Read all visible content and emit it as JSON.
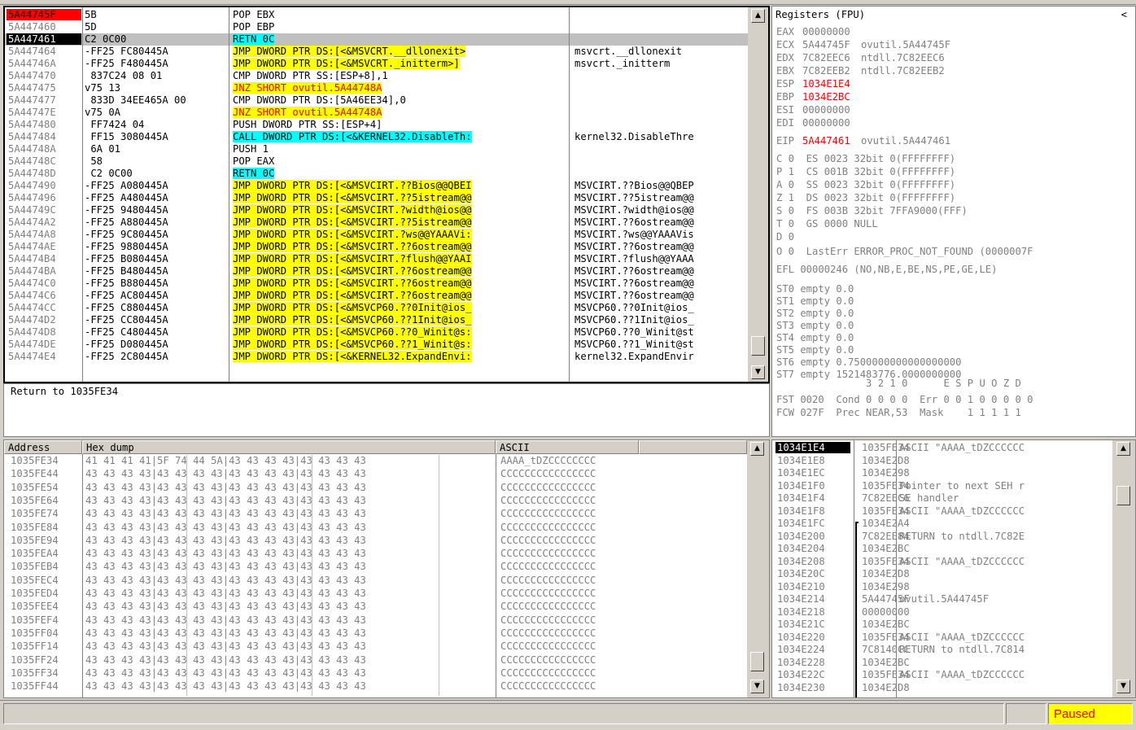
{
  "colors": {
    "yellow": "#ffff00",
    "cyan": "#00ffff",
    "red_highlight": "#ff0000",
    "selected": "#000000",
    "scroll_gray": "#d4d0c8",
    "paused_bg": "#ffff00",
    "paused_text": "#ff0000"
  },
  "disasm": {
    "rows": [
      {
        "addr": "5A44745F",
        "hex": "5B",
        "ins": "POP EBX",
        "cmt": "",
        "addr_style": "red"
      },
      {
        "addr": "5A447460",
        "hex": "5D",
        "ins": "POP EBP",
        "cmt": ""
      },
      {
        "addr": "5A447461",
        "hex": "C2 0C00",
        "ins": "RETN 0C",
        "cmt": "",
        "addr_style": "black",
        "ins_hl": "cyan",
        "row_hl": "gray"
      },
      {
        "addr": "5A447464",
        "hex": "-FF25 FC80445A",
        "ins": "JMP DWORD PTR DS:[<&MSVCRT.__dllonexit>",
        "cmt": "msvcrt.__dllonexit",
        "ins_hl": "yellow"
      },
      {
        "addr": "5A44746A",
        "hex": "-FF25 F480445A",
        "ins": "JMP DWORD PTR DS:[<&MSVCRT._initterm>]",
        "cmt": "msvcrt._initterm",
        "ins_hl": "yellow"
      },
      {
        "addr": "5A447470",
        "hex": " 837C24 08 01",
        "ins": "CMP DWORD PTR SS:[ESP+8],1",
        "cmt": ""
      },
      {
        "addr": "5A447475",
        "hex": "v75 13",
        "ins": "JNZ SHORT ovutil.5A44748A",
        "cmt": "",
        "ins_hl": "yellow",
        "ins_color": "red"
      },
      {
        "addr": "5A447477",
        "hex": " 833D 34EE465A 00",
        "ins": "CMP DWORD PTR DS:[5A46EE34],0",
        "cmt": ""
      },
      {
        "addr": "5A44747E",
        "hex": "v75 0A",
        "ins": "JNZ SHORT ovutil.5A44748A",
        "cmt": "",
        "ins_hl": "yellow",
        "ins_color": "red"
      },
      {
        "addr": "5A447480",
        "hex": " FF7424 04",
        "ins": "PUSH DWORD PTR SS:[ESP+4]",
        "cmt": ""
      },
      {
        "addr": "5A447484",
        "hex": " FF15 3080445A",
        "ins": "CALL DWORD PTR DS:[<&KERNEL32.DisableTh:",
        "cmt": "kernel32.DisableThre",
        "ins_hl": "cyan"
      },
      {
        "addr": "5A44748A",
        "hex": " 6A 01",
        "ins": "PUSH 1",
        "cmt": ""
      },
      {
        "addr": "5A44748C",
        "hex": " 58",
        "ins": "POP EAX",
        "cmt": ""
      },
      {
        "addr": "5A44748D",
        "hex": " C2 0C00",
        "ins": "RETN 0C",
        "cmt": "",
        "ins_hl": "cyan"
      },
      {
        "addr": "5A447490",
        "hex": "-FF25 A080445A",
        "ins": "JMP DWORD PTR DS:[<&MSVCIRT.??Bios@@QBEI",
        "cmt": "MSVCIRT.??Bios@@QBEP",
        "ins_hl": "yellow"
      },
      {
        "addr": "5A447496",
        "hex": "-FF25 A480445A",
        "ins": "JMP DWORD PTR DS:[<&MSVCIRT.??5istream@@",
        "cmt": "MSVCIRT.??5istream@@",
        "ins_hl": "yellow"
      },
      {
        "addr": "5A44749C",
        "hex": "-FF25 9480445A",
        "ins": "JMP DWORD PTR DS:[<&MSVCIRT.?width@ios@@",
        "cmt": "MSVCIRT.?width@ios@@",
        "ins_hl": "yellow"
      },
      {
        "addr": "5A4474A2",
        "hex": "-FF25 A880445A",
        "ins": "JMP DWORD PTR DS:[<&MSVCIRT.??5istream@@",
        "cmt": "MSVCIRT.??6ostream@@",
        "ins_hl": "yellow"
      },
      {
        "addr": "5A4474A8",
        "hex": "-FF25 9C80445A",
        "ins": "JMP DWORD PTR DS:[<&MSVCIRT.?ws@@YAAAVi:",
        "cmt": "MSVCIRT.?ws@@YAAAVis",
        "ins_hl": "yellow"
      },
      {
        "addr": "5A4474AE",
        "hex": "-FF25 9880445A",
        "ins": "JMP DWORD PTR DS:[<&MSVCIRT.??6ostream@@",
        "cmt": "MSVCIRT.??6ostream@@",
        "ins_hl": "yellow"
      },
      {
        "addr": "5A4474B4",
        "hex": "-FF25 B080445A",
        "ins": "JMP DWORD PTR DS:[<&MSVCIRT.?flush@@YAAI",
        "cmt": "MSVCIRT.?flush@@YAAA",
        "ins_hl": "yellow"
      },
      {
        "addr": "5A4474BA",
        "hex": "-FF25 B480445A",
        "ins": "JMP DWORD PTR DS:[<&MSVCIRT.??6ostream@@",
        "cmt": "MSVCIRT.??6ostream@@",
        "ins_hl": "yellow"
      },
      {
        "addr": "5A4474C0",
        "hex": "-FF25 B880445A",
        "ins": "JMP DWORD PTR DS:[<&MSVCIRT.??6ostream@@",
        "cmt": "MSVCIRT.??6ostream@@",
        "ins_hl": "yellow"
      },
      {
        "addr": "5A4474C6",
        "hex": "-FF25 AC80445A",
        "ins": "JMP DWORD PTR DS:[<&MSVCIRT.??6ostream@@",
        "cmt": "MSVCIRT.??6ostream@@",
        "ins_hl": "yellow"
      },
      {
        "addr": "5A4474CC",
        "hex": "-FF25 C880445A",
        "ins": "JMP DWORD PTR DS:[<&MSVCP60.??0Init@ios_",
        "cmt": "MSVCP60.??0Init@ios_",
        "ins_hl": "yellow"
      },
      {
        "addr": "5A4474D2",
        "hex": "-FF25 CC80445A",
        "ins": "JMP DWORD PTR DS:[<&MSVCP60.??1Init@ios_",
        "cmt": "MSVCP60.??1Init@ios_",
        "ins_hl": "yellow"
      },
      {
        "addr": "5A4474D8",
        "hex": "-FF25 C480445A",
        "ins": "JMP DWORD PTR DS:[<&MSVCP60.??0_Winit@s:",
        "cmt": "MSVCP60.??0_Winit@st",
        "ins_hl": "yellow"
      },
      {
        "addr": "5A4474DE",
        "hex": "-FF25 D080445A",
        "ins": "JMP DWORD PTR DS:[<&MSVCP60.??1_Winit@s:",
        "cmt": "MSVCP60.??1_Winit@st",
        "ins_hl": "yellow"
      },
      {
        "addr": "5A4474E4",
        "hex": "-FF25 2C80445A",
        "ins": "JMP DWORD PTR DS:[<&KERNEL32.ExpandEnvi:",
        "cmt": "kernel32.ExpandEnvir",
        "ins_hl": "yellow"
      }
    ]
  },
  "info": {
    "text": "Return to 1035FE34"
  },
  "registers": {
    "title": "Registers (FPU)",
    "collapse_glyph": "<",
    "lines": [
      {
        "name": "EAX",
        "value": "00000000",
        "extra": "",
        "value_color": "gray"
      },
      {
        "name": "ECX",
        "value": "5A44745F",
        "extra": "ovutil.5A44745F",
        "value_color": "gray"
      },
      {
        "name": "EDX",
        "value": "7C82EEC6",
        "extra": "ntdll.7C82EEC6",
        "value_color": "gray"
      },
      {
        "name": "EBX",
        "value": "7C82EEB2",
        "extra": "ntdll.7C82EEB2",
        "value_color": "gray"
      },
      {
        "name": "ESP",
        "value": "1034E1E4",
        "extra": "",
        "value_color": "red"
      },
      {
        "name": "EBP",
        "value": "1034E2BC",
        "extra": "",
        "value_color": "red"
      },
      {
        "name": "ESI",
        "value": "00000000",
        "extra": "",
        "value_color": "gray"
      },
      {
        "name": "EDI",
        "value": "00000000",
        "extra": "",
        "value_color": "gray"
      }
    ],
    "eip": {
      "name": "EIP",
      "value": "5A447461",
      "extra": "ovutil.5A447461"
    },
    "flags": [
      "C 0  ES 0023 32bit 0(FFFFFFFF)",
      "P 1  CS 001B 32bit 0(FFFFFFFF)",
      "A 0  SS 0023 32bit 0(FFFFFFFF)",
      "Z 1  DS 0023 32bit 0(FFFFFFFF)",
      "S 0  FS 003B 32bit 7FFA9000(FFF)",
      "T 0  GS 0000 NULL",
      "D 0",
      "O 0  LastErr ERROR_PROC_NOT_FOUND (0000007F"
    ],
    "efl": "EFL 00000246 (NO,NB,E,BE,NS,PE,GE,LE)",
    "fpu": [
      "ST0 empty 0.0",
      "ST1 empty 0.0",
      "ST2 empty 0.0",
      "ST3 empty 0.0",
      "ST4 empty 0.0",
      "ST5 empty 0.0",
      "ST6 empty 0.7500000000000000000",
      "ST7 empty 1521483776.0000000000"
    ],
    "fpu_header": "               3 2 1 0      E S P U O Z D",
    "fst": "FST 0020  Cond 0 0 0 0  Err 0 0 1 0 0 0 0 0",
    "fcw": "FCW 027F  Prec NEAR,53  Mask    1 1 1 1 1"
  },
  "dump": {
    "headers": {
      "address": "Address",
      "hex": "Hex dump",
      "ascii": "ASCII"
    },
    "rows": [
      {
        "addr": "1035FE34",
        "hex": "41 41 41 41|5F 74 44 5A|43 43 43 43|43 43 43 43",
        "ascii": "AAAA_tDZCCCCCCCC"
      },
      {
        "addr": "1035FE44",
        "hex": "43 43 43 43|43 43 43 43|43 43 43 43|43 43 43 43",
        "ascii": "CCCCCCCCCCCCCCCC"
      },
      {
        "addr": "1035FE54",
        "hex": "43 43 43 43|43 43 43 43|43 43 43 43|43 43 43 43",
        "ascii": "CCCCCCCCCCCCCCCC"
      },
      {
        "addr": "1035FE64",
        "hex": "43 43 43 43|43 43 43 43|43 43 43 43|43 43 43 43",
        "ascii": "CCCCCCCCCCCCCCCC"
      },
      {
        "addr": "1035FE74",
        "hex": "43 43 43 43|43 43 43 43|43 43 43 43|43 43 43 43",
        "ascii": "CCCCCCCCCCCCCCCC"
      },
      {
        "addr": "1035FE84",
        "hex": "43 43 43 43|43 43 43 43|43 43 43 43|43 43 43 43",
        "ascii": "CCCCCCCCCCCCCCCC"
      },
      {
        "addr": "1035FE94",
        "hex": "43 43 43 43|43 43 43 43|43 43 43 43|43 43 43 43",
        "ascii": "CCCCCCCCCCCCCCCC"
      },
      {
        "addr": "1035FEA4",
        "hex": "43 43 43 43|43 43 43 43|43 43 43 43|43 43 43 43",
        "ascii": "CCCCCCCCCCCCCCCC"
      },
      {
        "addr": "1035FEB4",
        "hex": "43 43 43 43|43 43 43 43|43 43 43 43|43 43 43 43",
        "ascii": "CCCCCCCCCCCCCCCC"
      },
      {
        "addr": "1035FEC4",
        "hex": "43 43 43 43|43 43 43 43|43 43 43 43|43 43 43 43",
        "ascii": "CCCCCCCCCCCCCCCC"
      },
      {
        "addr": "1035FED4",
        "hex": "43 43 43 43|43 43 43 43|43 43 43 43|43 43 43 43",
        "ascii": "CCCCCCCCCCCCCCCC"
      },
      {
        "addr": "1035FEE4",
        "hex": "43 43 43 43|43 43 43 43|43 43 43 43|43 43 43 43",
        "ascii": "CCCCCCCCCCCCCCCC"
      },
      {
        "addr": "1035FEF4",
        "hex": "43 43 43 43|43 43 43 43|43 43 43 43|43 43 43 43",
        "ascii": "CCCCCCCCCCCCCCCC"
      },
      {
        "addr": "1035FF04",
        "hex": "43 43 43 43|43 43 43 43|43 43 43 43|43 43 43 43",
        "ascii": "CCCCCCCCCCCCCCCC"
      },
      {
        "addr": "1035FF14",
        "hex": "43 43 43 43|43 43 43 43|43 43 43 43|43 43 43 43",
        "ascii": "CCCCCCCCCCCCCCCC"
      },
      {
        "addr": "1035FF24",
        "hex": "43 43 43 43|43 43 43 43|43 43 43 43|43 43 43 43",
        "ascii": "CCCCCCCCCCCCCCCC"
      },
      {
        "addr": "1035FF34",
        "hex": "43 43 43 43|43 43 43 43|43 43 43 43|43 43 43 43",
        "ascii": "CCCCCCCCCCCCCCCC"
      },
      {
        "addr": "1035FF44",
        "hex": "43 43 43 43|43 43 43 43|43 43 43 43|43 43 43 43",
        "ascii": "CCCCCCCCCCCCCCCC"
      }
    ]
  },
  "stack": {
    "rows": [
      {
        "addr": "1034E1E4",
        "value": "1035FE34",
        "comment": "ASCII \"AAAA_tDZCCCCCC",
        "selected": true
      },
      {
        "addr": "1034E1E8",
        "value": "1034E2D8",
        "comment": ""
      },
      {
        "addr": "1034E1EC",
        "value": "1034E298",
        "comment": ""
      },
      {
        "addr": "1034E1F0",
        "value": "1035FE34",
        "comment": "Pointer to next SEH r"
      },
      {
        "addr": "1034E1F4",
        "value": "7C82EEC6",
        "comment": "SE handler"
      },
      {
        "addr": "1034E1F8",
        "value": "1035FE34",
        "comment": "ASCII \"AAAA_tDZCCCCCC"
      },
      {
        "addr": "1034E1FC",
        "value": "1034E2A4",
        "comment": ""
      },
      {
        "addr": "1034E200",
        "value": "7C82EE84",
        "comment": "RETURN to ntdll.7C82E"
      },
      {
        "addr": "1034E204",
        "value": "1034E2BC",
        "comment": ""
      },
      {
        "addr": "1034E208",
        "value": "1035FE34",
        "comment": "ASCII \"AAAA_tDZCCCCCC"
      },
      {
        "addr": "1034E20C",
        "value": "1034E2D8",
        "comment": ""
      },
      {
        "addr": "1034E210",
        "value": "1034E298",
        "comment": ""
      },
      {
        "addr": "1034E214",
        "value": "5A44745F",
        "comment": "ovutil.5A44745F"
      },
      {
        "addr": "1034E218",
        "value": "00000000",
        "comment": ""
      },
      {
        "addr": "1034E21C",
        "value": "1034E2BC",
        "comment": ""
      },
      {
        "addr": "1034E220",
        "value": "1035FE34",
        "comment": "ASCII \"AAAA_tDZCCCCCC"
      },
      {
        "addr": "1034E224",
        "value": "7C8140CC",
        "comment": "RETURN to ntdll.7C814"
      },
      {
        "addr": "1034E228",
        "value": "1034E2BC",
        "comment": ""
      },
      {
        "addr": "1034E22C",
        "value": "1035FE34",
        "comment": "ASCII \"AAAA_tDZCCCCCC"
      },
      {
        "addr": "1034E230",
        "value": "1034E2D8",
        "comment": ""
      }
    ]
  },
  "scroll": {
    "up": "▲",
    "down": "▼"
  },
  "status": {
    "state": "Paused",
    "message": ""
  }
}
